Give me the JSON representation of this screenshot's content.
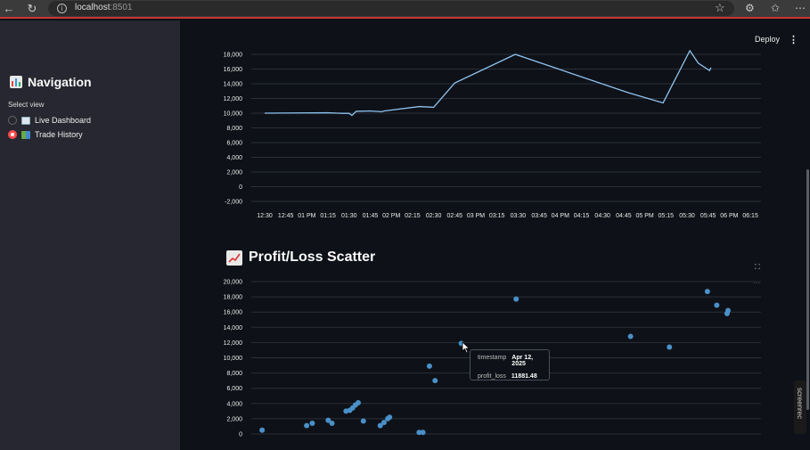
{
  "browser": {
    "url_host": "localhost",
    "url_port": ":8501"
  },
  "sidebar": {
    "title": "Navigation",
    "select_label": "Select view",
    "options": [
      {
        "label": "Live Dashboard",
        "selected": false
      },
      {
        "label": "Trade History",
        "selected": true
      }
    ]
  },
  "header": {
    "deploy_label": "Deploy",
    "menu_icon": "kebab-menu-icon"
  },
  "line_chart": {
    "chart_data": {
      "type": "line",
      "x": [
        "12:30",
        "12:45",
        "01 PM",
        "01:15",
        "01:30",
        "01:45",
        "02 PM",
        "02:15",
        "02:30",
        "02:45",
        "03 PM",
        "03:15",
        "03:30",
        "03:45",
        "04 PM",
        "04:15",
        "04:30",
        "04:45",
        "05 PM",
        "05:15",
        "05:30",
        "05:45",
        "06 PM",
        "06:15"
      ],
      "y_ticks": [
        "18,000",
        "16,000",
        "14,000",
        "12,000",
        "10,000",
        "8,000",
        "6,000",
        "4,000",
        "2,000",
        "0",
        "-2,000"
      ],
      "points": [
        {
          "x": "12:30",
          "y": 10000
        },
        {
          "x": "01:15",
          "y": 10050
        },
        {
          "x": "01:25",
          "y": 9980
        },
        {
          "x": "01:30",
          "y": 9980
        },
        {
          "x": "01:32",
          "y": 9700
        },
        {
          "x": "01:35",
          "y": 10250
        },
        {
          "x": "01:45",
          "y": 10300
        },
        {
          "x": "01:53",
          "y": 10200
        },
        {
          "x": "01:55",
          "y": 10300
        },
        {
          "x": "02:20",
          "y": 10900
        },
        {
          "x": "02:30",
          "y": 10800
        },
        {
          "x": "02:45",
          "y": 14100
        },
        {
          "x": "03:28",
          "y": 18000
        },
        {
          "x": "04:48",
          "y": 12800
        },
        {
          "x": "05:13",
          "y": 11400
        },
        {
          "x": "05:32",
          "y": 18500
        },
        {
          "x": "05:38",
          "y": 16800
        },
        {
          "x": "05:46",
          "y": 15800
        },
        {
          "x": "05:47",
          "y": 16200
        }
      ],
      "ylim": [
        -2000,
        18000
      ],
      "grid": true,
      "color": "#8ec3f0"
    }
  },
  "scatter_chart": {
    "title": "Profit/Loss Scatter",
    "title_icon": "chart-increasing-icon",
    "fullscreen_icon": "fullscreen-icon",
    "chart_data": {
      "type": "scatter",
      "y_ticks": [
        "20,000",
        "18,000",
        "16,000",
        "14,000",
        "12,000",
        "10,000",
        "8,000",
        "6,000",
        "4,000",
        "2,000",
        "0"
      ],
      "ylim": [
        0,
        20000
      ],
      "grid": true,
      "color": "#4a90c8",
      "points": [
        {
          "x": 0.006,
          "y": 500
        },
        {
          "x": 0.101,
          "y": 1100
        },
        {
          "x": 0.113,
          "y": 1400
        },
        {
          "x": 0.147,
          "y": 1800
        },
        {
          "x": 0.155,
          "y": 1400
        },
        {
          "x": 0.185,
          "y": 3000
        },
        {
          "x": 0.193,
          "y": 3100
        },
        {
          "x": 0.199,
          "y": 3400
        },
        {
          "x": 0.205,
          "y": 3800
        },
        {
          "x": 0.211,
          "y": 4100
        },
        {
          "x": 0.222,
          "y": 1700
        },
        {
          "x": 0.258,
          "y": 1100
        },
        {
          "x": 0.266,
          "y": 1500
        },
        {
          "x": 0.274,
          "y": 2000
        },
        {
          "x": 0.278,
          "y": 2200
        },
        {
          "x": 0.341,
          "y": 200
        },
        {
          "x": 0.349,
          "y": 200
        },
        {
          "x": 0.363,
          "y": 8900
        },
        {
          "x": 0.375,
          "y": 7000
        },
        {
          "x": 0.431,
          "y": 11881.48
        },
        {
          "x": 0.548,
          "y": 17700
        },
        {
          "x": 0.792,
          "y": 12800
        },
        {
          "x": 0.875,
          "y": 11400
        },
        {
          "x": 0.956,
          "y": 18700
        },
        {
          "x": 0.976,
          "y": 16900
        },
        {
          "x": 0.998,
          "y": 15800
        },
        {
          "x": 1.0,
          "y": 16200
        }
      ]
    },
    "tooltip": {
      "timestamp_key": "timestamp",
      "timestamp_value": "Apr 12, 2025",
      "profit_key": "profit_loss",
      "profit_value": "11881.48"
    }
  },
  "overlay": {
    "screenrec_label": "screenrec"
  }
}
